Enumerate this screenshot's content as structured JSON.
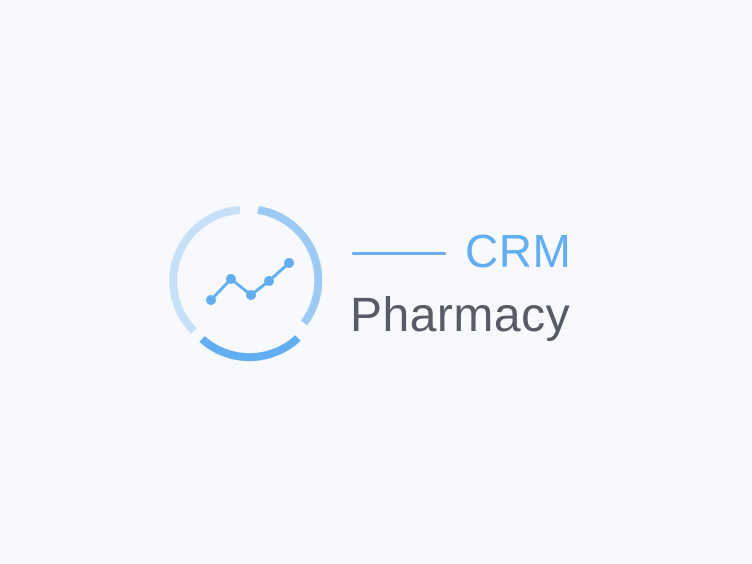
{
  "brand": {
    "top_word": "CRM",
    "bottom_word": "Pharmacy",
    "colors": {
      "background": "#f7f9fc",
      "accent": "#62aef2",
      "accent_light": "#c6e0f8",
      "accent_mid": "#9ccaf4",
      "text_dark": "#575b66"
    },
    "icon": "rising-chart-ring-icon"
  }
}
